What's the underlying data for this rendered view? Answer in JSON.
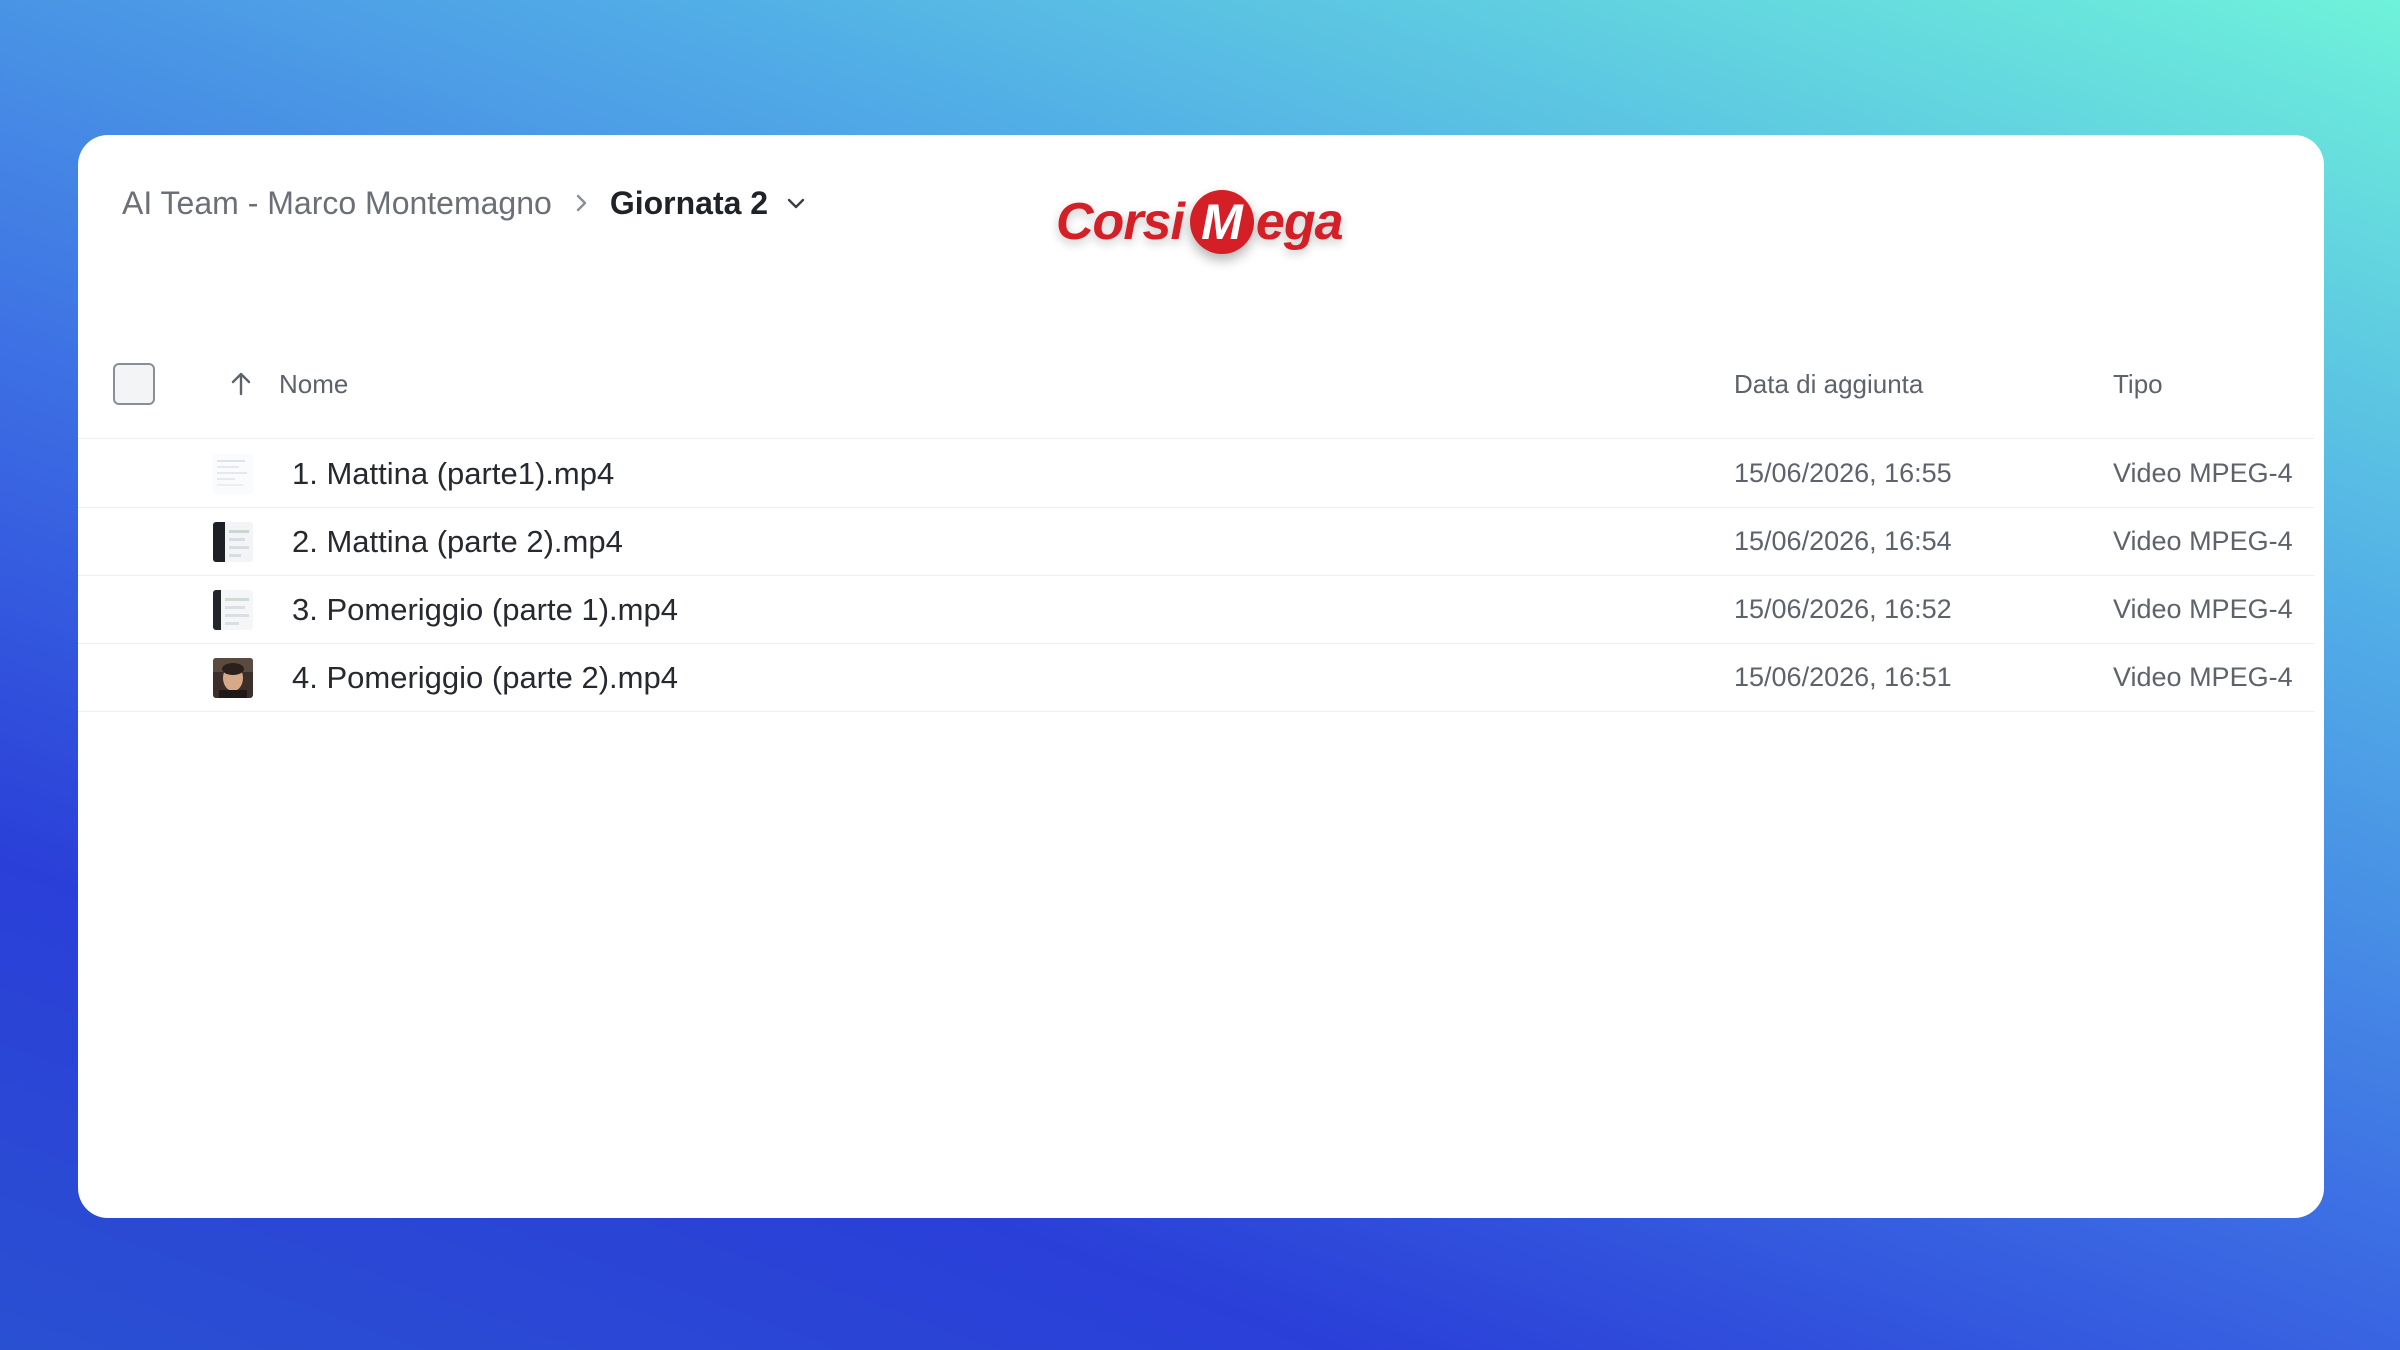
{
  "breadcrumb": {
    "parent": "AI Team - Marco Montemagno",
    "current": "Giornata 2",
    "separator_icon": "chevron-right-icon",
    "dropdown_icon": "chevron-down-icon"
  },
  "logo": {
    "before": "Corsi",
    "badge": "M",
    "after": "ega",
    "brand_color": "#d41f26"
  },
  "table": {
    "sort_icon": "arrow-up-icon",
    "columns": {
      "name": "Nome",
      "date": "Data di aggiunta",
      "type": "Tipo"
    },
    "rows": [
      {
        "name": "1. Mattina (parte1).mp4",
        "date": "15/06/2026, 16:55",
        "type": "Video MPEG-4"
      },
      {
        "name": "2. Mattina (parte 2).mp4",
        "date": "15/06/2026, 16:54",
        "type": "Video MPEG-4"
      },
      {
        "name": "3. Pomeriggio (parte 1).mp4",
        "date": "15/06/2026, 16:52",
        "type": "Video MPEG-4"
      },
      {
        "name": "4. Pomeriggio (parte 2).mp4",
        "date": "15/06/2026, 16:51",
        "type": "Video MPEG-4"
      }
    ]
  }
}
